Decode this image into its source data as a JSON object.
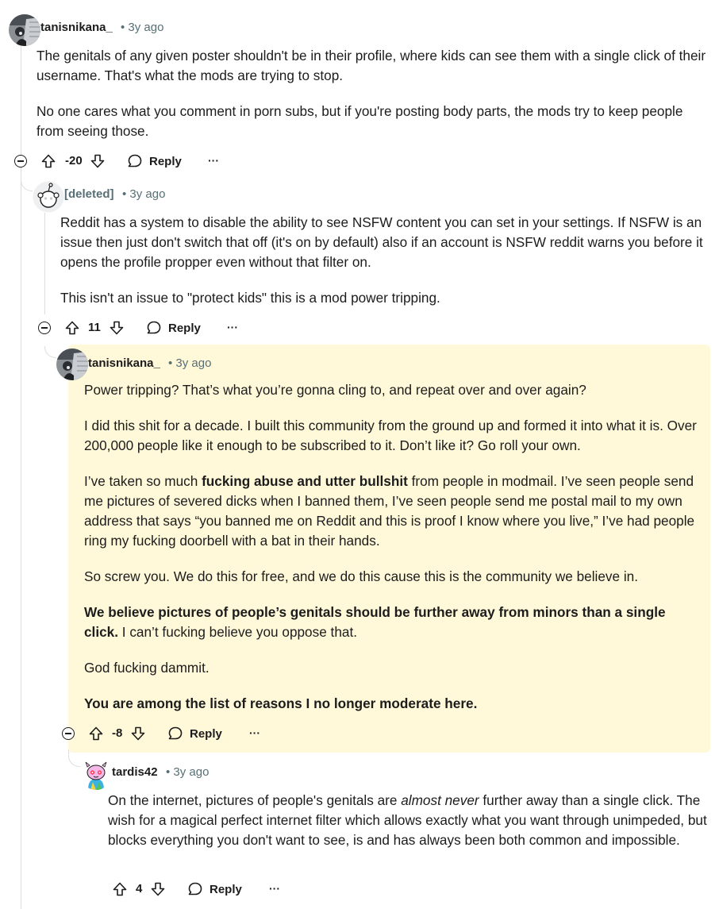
{
  "comments": [
    {
      "author": "tanisnikana_",
      "time": "• 3y ago",
      "paragraphs": [
        "The genitals of any given poster shouldn't be in their profile, where kids can see them with a single click of their username. That's what the mods are trying to stop.",
        "No one cares what you comment in porn subs, but if you're posting body parts, the mods try to keep people from seeing those."
      ],
      "score": "-20",
      "reply_label": "Reply",
      "more_label": "···"
    },
    {
      "author": "[deleted]",
      "time": "• 3y ago",
      "paragraphs": [
        "Reddit has a system to disable the ability to see NSFW content you can set in your settings. If NSFW is an issue then just don't switch that off (it's on by default) also if an account is NSFW reddit warns you before it opens the profile propper even without that filter on.",
        "This isn't an issue to \"protect kids\" this is a mod power tripping."
      ],
      "score": "11",
      "reply_label": "Reply",
      "more_label": "···"
    },
    {
      "author": "tanisnikana_",
      "time": "• 3y ago",
      "paragraphs": [
        "Power tripping? That’s what you’re gonna cling to, and repeat over and over again?",
        "I did this shit for a decade. I built this community from the ground up and formed it into what it is. Over 200,000 people like it enough to be subscribed to it. Don’t like it? Go roll your own."
      ],
      "p3_before": "I’ve taken so much ",
      "p3_bold": "fucking abuse and utter bullshit",
      "p3_after": " from people in modmail. I’ve seen people send me pictures of severed dicks when I banned them, I’ve seen people send me postal mail to my own address that says “you banned me on Reddit and this is proof I know where you live,” I’ve had people ring my fucking doorbell with a bat in their hands.",
      "p4": "So screw you. We do this for free, and we do this cause this is the community we believe in.",
      "p5_bold": "We believe pictures of people’s genitals should be further away from minors than a single click.",
      "p5_after": " I can’t fucking believe you oppose that.",
      "p6": "God fucking dammit.",
      "p7_bold": "You are among the list of reasons I no longer moderate here.",
      "score": "-8",
      "reply_label": "Reply",
      "more_label": "···",
      "highlight_color": "#fff9d9"
    },
    {
      "author": "tardis42",
      "time": "• 3y ago",
      "p1_before": "On the internet, pictures of people's genitals are ",
      "p1_italic": "almost never",
      "p1_after": " further away than a single click. The wish for a magical perfect internet filter which allows exactly what you want through unimpeded, but blocks everything you don't want to see, is and has always been both common and impossible.",
      "score": "4",
      "reply_label": "Reply",
      "more_label": "···"
    }
  ]
}
